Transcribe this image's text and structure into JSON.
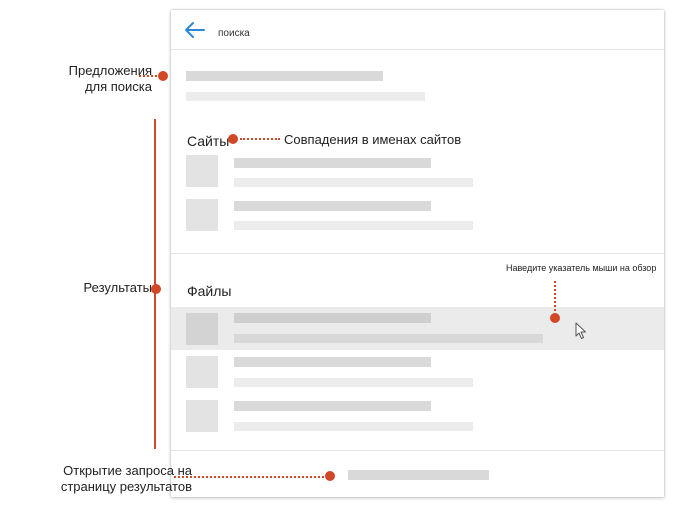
{
  "search": {
    "query": "поиска"
  },
  "sections": {
    "sites": "Сайты",
    "files": "Файлы"
  },
  "annotations": {
    "suggestions": "Предложения\nдля поиска",
    "results": "Результаты",
    "site_matches": "Совпадения в именах сайтов",
    "hover_preview": "Наведите указатель мыши на обзор",
    "open_query": "Открытие запроса на\nстраницу результатов"
  },
  "colors": {
    "accent": "#d24726",
    "back_arrow": "#2b88d8"
  },
  "icons": [
    "back-arrow-icon",
    "cursor-icon"
  ]
}
